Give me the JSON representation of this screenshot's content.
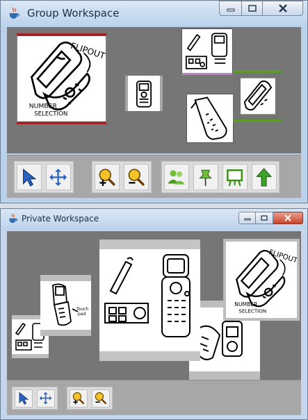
{
  "group_window": {
    "title": "Group Workspace",
    "controls": [
      "minimize",
      "maximize",
      "close"
    ],
    "toolbar_groups": [
      [
        "pointer-tool",
        "move-tool"
      ],
      [
        "zoom-in-tool",
        "zoom-out-tool"
      ],
      [
        "users-tool",
        "pin-tool",
        "presentation-tool",
        "upload-arrow-tool"
      ]
    ],
    "sketches": [
      {
        "name": "flipout-sketch",
        "label": "FLIPOUT",
        "caption": [
          "NUMBER",
          "SELECTION"
        ],
        "frame": "red"
      },
      {
        "name": "small-phone-sketch",
        "frame": "gray"
      },
      {
        "name": "phone-parts-sketch",
        "frame": "purple"
      },
      {
        "name": "keypad-phone-sketch",
        "frame": "none"
      },
      {
        "name": "slider-phone-sketch",
        "frame": "green"
      }
    ],
    "colors": {
      "selection_red": "#a3232b",
      "selection_green": "#5d9a2c",
      "selection_purple": "#b884c4"
    }
  },
  "private_window": {
    "title": "Private Workspace",
    "controls": [
      "minimize",
      "maximize",
      "close"
    ],
    "toolbar_groups": [
      [
        "pointer-tool",
        "move-tool"
      ],
      [
        "zoom-in-tool",
        "zoom-out-tool"
      ]
    ],
    "sketches": [
      {
        "name": "small-parts-sketch"
      },
      {
        "name": "flip-phone-sketch",
        "caption": "Touch pad"
      },
      {
        "name": "large-phones-sketch"
      },
      {
        "name": "player-sketch"
      },
      {
        "name": "flipout-sketch",
        "label": "FLIPOUT",
        "caption": [
          "NUMBER",
          "SELECTION"
        ]
      }
    ]
  }
}
